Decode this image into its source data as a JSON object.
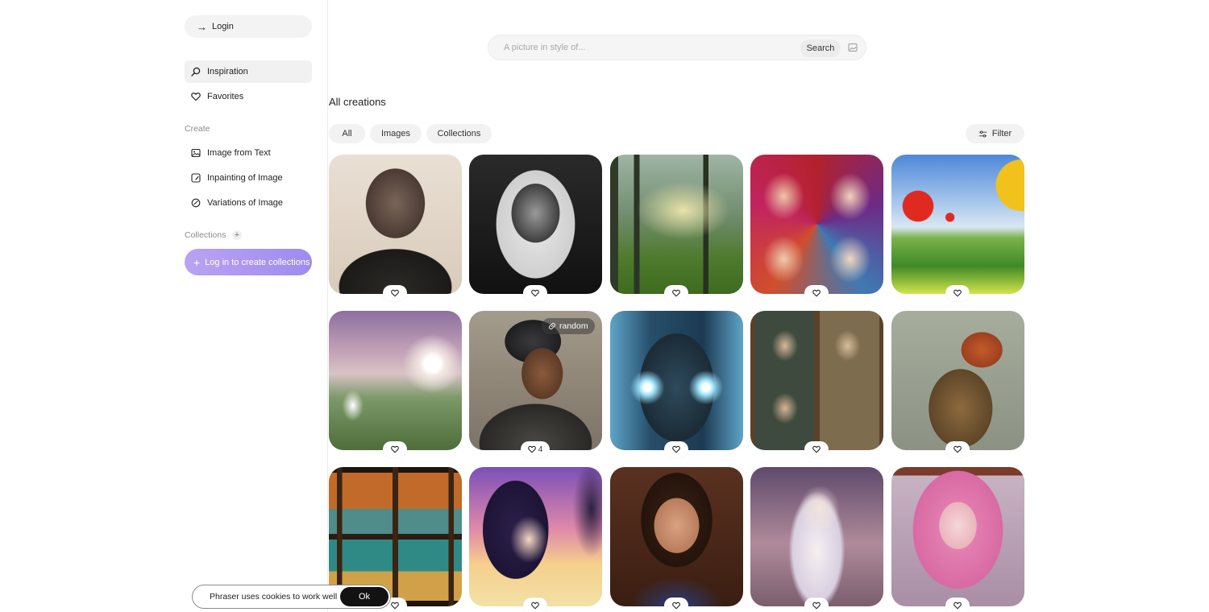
{
  "sidebar": {
    "login_label": "Login",
    "nav": [
      {
        "label": "Inspiration",
        "icon": "search-icon",
        "active": true
      },
      {
        "label": "Favorites",
        "icon": "heart-icon",
        "active": false
      }
    ],
    "create_section_label": "Create",
    "create_items": [
      {
        "label": "Image from Text",
        "icon": "image-icon"
      },
      {
        "label": "Inpainting of Image",
        "icon": "inpaint-icon"
      },
      {
        "label": "Variations of Image",
        "icon": "variations-icon"
      }
    ],
    "collections_section_label": "Collections",
    "create_collections_label": "Log in to create collections"
  },
  "search": {
    "placeholder": "A picture in style of...",
    "button_label": "Search"
  },
  "main": {
    "title": "All creations",
    "tabs": [
      {
        "label": "All"
      },
      {
        "label": "Images"
      },
      {
        "label": "Collections"
      }
    ],
    "filter_label": "Filter"
  },
  "gallery": {
    "items": [
      {
        "subject": "armored soldier portrait",
        "likes": ""
      },
      {
        "subject": "victorian engraving portrait",
        "likes": ""
      },
      {
        "subject": "sunlit forest",
        "likes": ""
      },
      {
        "subject": "geisha portrait collage",
        "likes": ""
      },
      {
        "subject": "hot air balloons over fields",
        "likes": ""
      },
      {
        "subject": "fairy on hilltop",
        "likes": ""
      },
      {
        "subject": "cyborg woman",
        "likes": "4",
        "badge": "random"
      },
      {
        "subject": "cyber man with glowing eyes",
        "likes": ""
      },
      {
        "subject": "paintings of women at laptops",
        "likes": ""
      },
      {
        "subject": "fox warrior",
        "likes": ""
      },
      {
        "subject": "landscapes through windows",
        "likes": ""
      },
      {
        "subject": "anime couple at sunset",
        "likes": ""
      },
      {
        "subject": "woman renaissance portrait",
        "likes": ""
      },
      {
        "subject": "white haired sorceress",
        "likes": ""
      },
      {
        "subject": "pink haired girl",
        "likes": ""
      }
    ]
  },
  "cookie": {
    "message": "Phraser uses cookies to work well",
    "ok_label": "Ok"
  }
}
